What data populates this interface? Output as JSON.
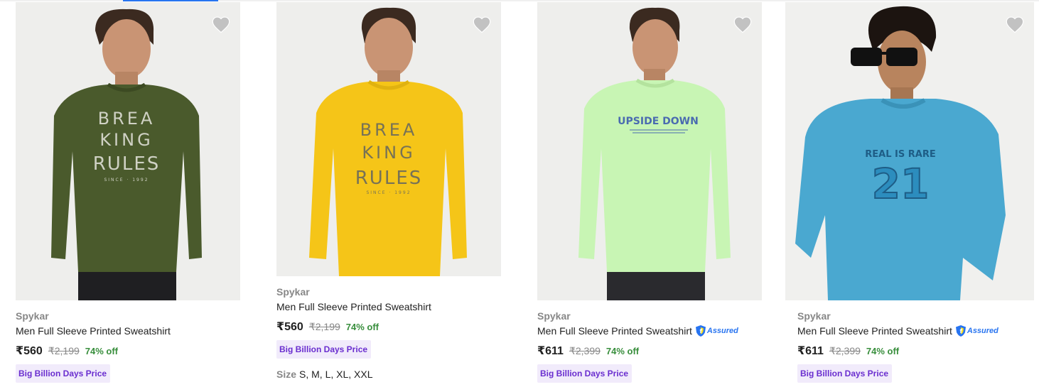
{
  "colors": {
    "accent": "#2874f0",
    "discount": "#388e3c",
    "badge_text": "#6a2ecf",
    "badge_bg": "#f1ebfb"
  },
  "products": [
    {
      "brand": "Spykar",
      "title": "Men Full Sleeve Printed Sweatshirt",
      "price": "₹560",
      "mrp": "₹2,199",
      "discount": "74% off",
      "badge": "Big Billion Days Price",
      "assured": false,
      "image_text": [
        "BREA",
        "KING",
        "RULES"
      ],
      "image_caption": "SINCE · 1992",
      "sweatshirt_color": "#4a5a2c"
    },
    {
      "brand": "Spykar",
      "title": "Men Full Sleeve Printed Sweatshirt",
      "price": "₹560",
      "mrp": "₹2,199",
      "discount": "74% off",
      "badge": "Big Billion Days Price",
      "assured": false,
      "sizes_label": "Size",
      "sizes": "S, M, L, XL, XXL",
      "image_text": [
        "BREA",
        "KING",
        "RULES"
      ],
      "image_caption": "SINCE · 1992",
      "sweatshirt_color": "#f5c518"
    },
    {
      "brand": "Spykar",
      "title": "Men Full Sleeve Printed Sweatshirt",
      "price": "₹611",
      "mrp": "₹2,399",
      "discount": "74% off",
      "badge": "Big Billion Days Price",
      "assured": true,
      "assured_label": "Assured",
      "image_text": [
        "UPSIDE DOWN"
      ],
      "sweatshirt_color": "#c8f5b4"
    },
    {
      "brand": "Spykar",
      "title": "Men Full Sleeve Printed Sweatshirt",
      "price": "₹611",
      "mrp": "₹2,399",
      "discount": "74% off",
      "badge": "Big Billion Days Price",
      "assured": true,
      "assured_label": "Assured",
      "image_text": [
        "REAL IS RARE",
        "21"
      ],
      "sweatshirt_color": "#4aa8d0"
    }
  ]
}
